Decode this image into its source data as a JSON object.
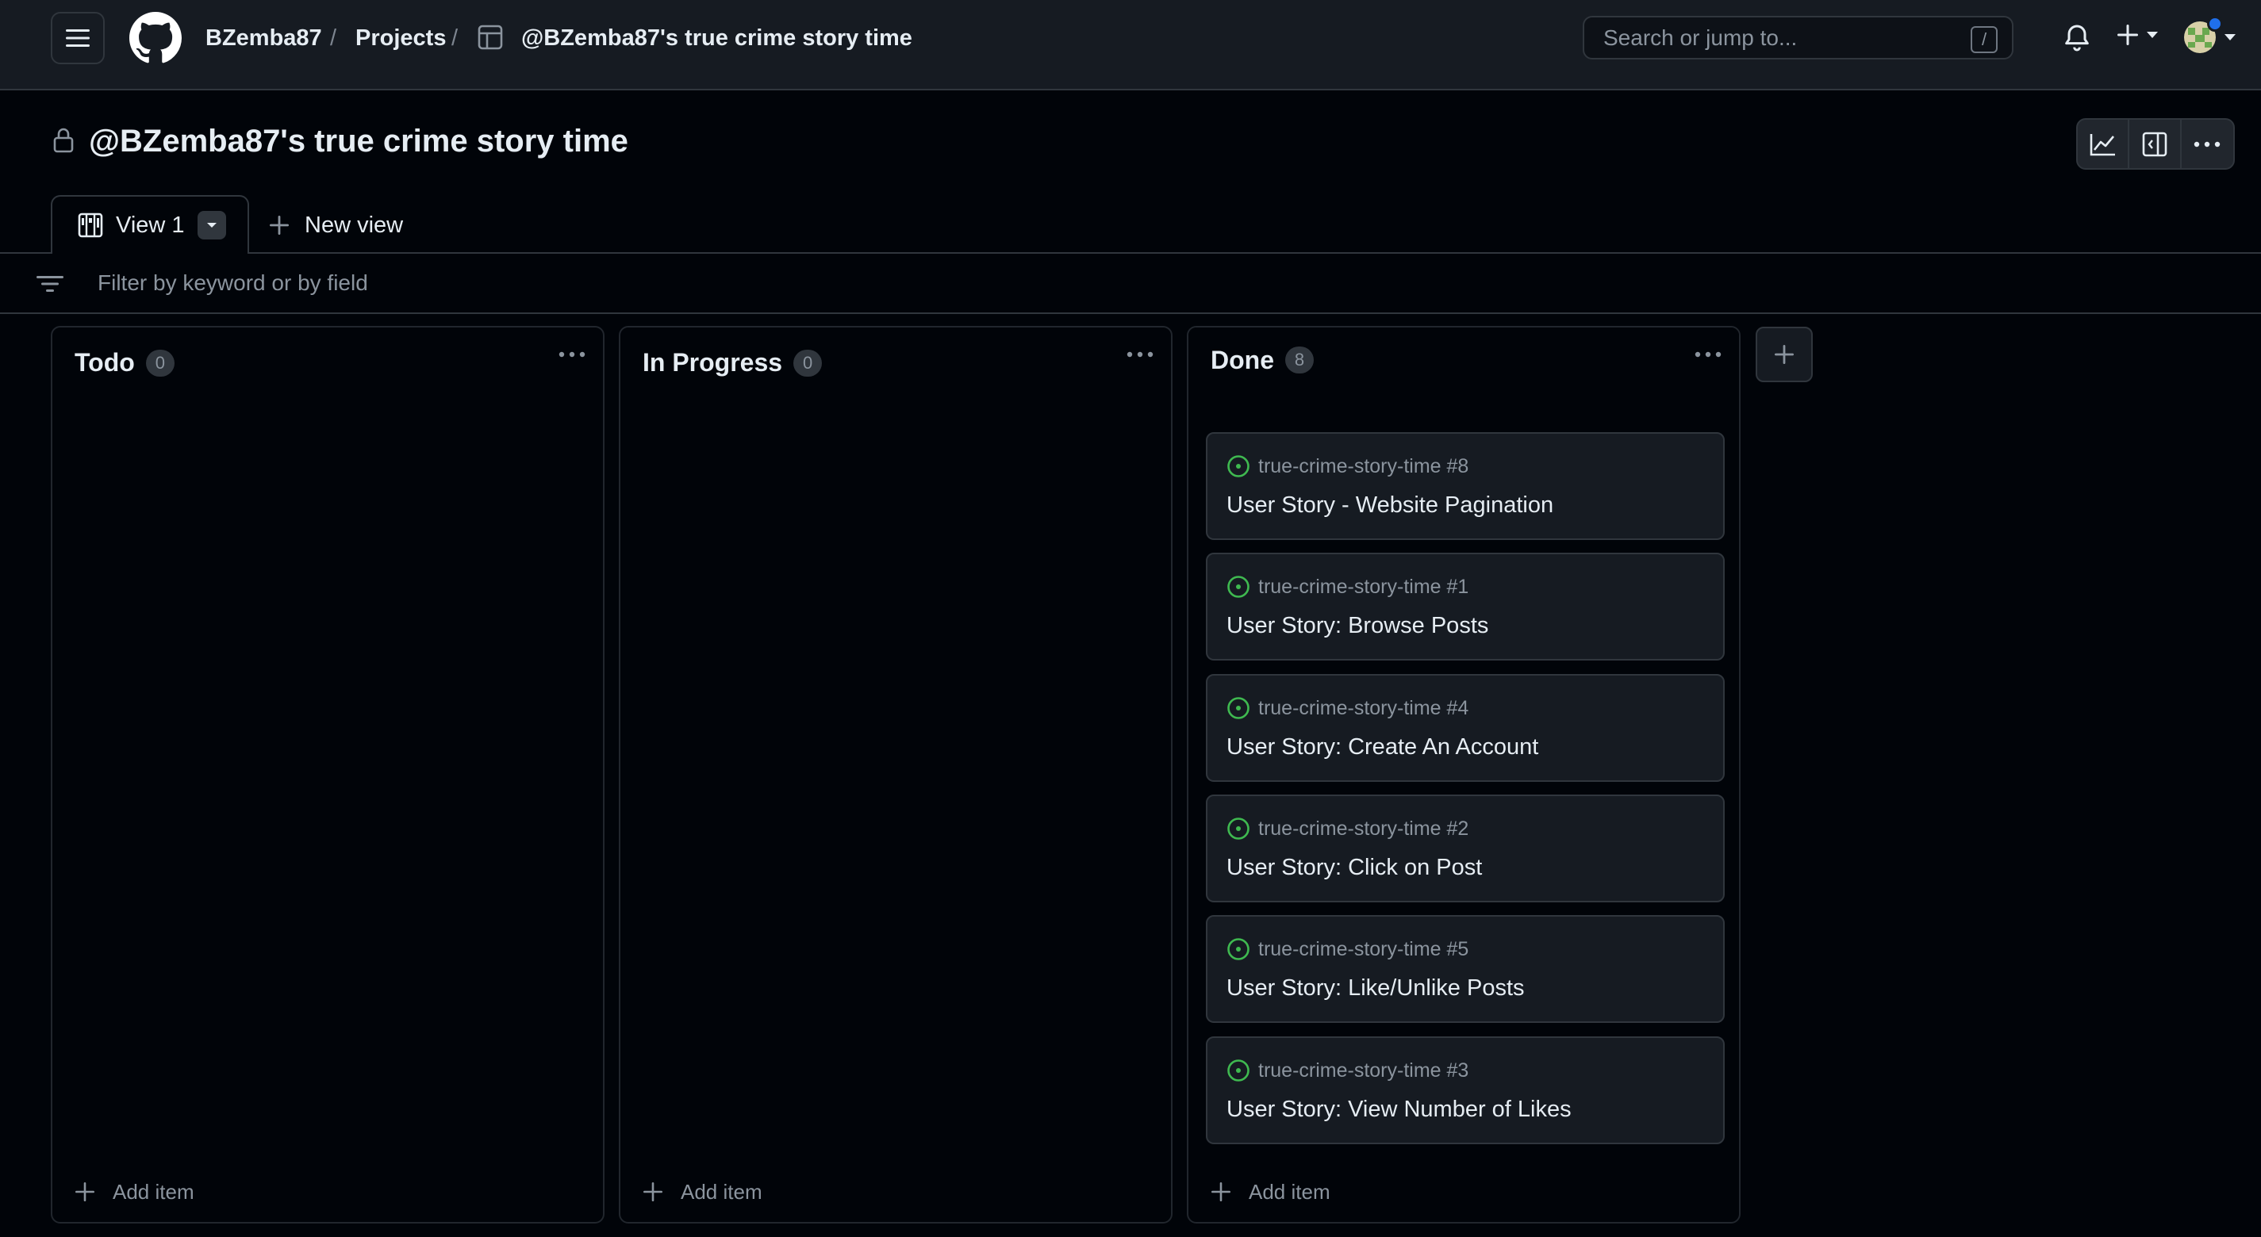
{
  "header": {
    "breadcrumb": {
      "owner": "BZemba87",
      "separator": "/",
      "projects": "Projects",
      "project": "@BZemba87's true crime story time"
    },
    "search": {
      "placeholder": "Search or jump to...",
      "shortcut": "/"
    },
    "icons": [
      "menu-icon",
      "github-logo",
      "project-table-icon",
      "bell-icon",
      "plus-icon",
      "avatar"
    ]
  },
  "project": {
    "title": "@BZemba87's true crime story time",
    "visibility_icon": "lock-icon",
    "actions": [
      "insights-graph-icon",
      "side-panel-icon",
      "more-options-icon"
    ]
  },
  "views": {
    "tabs": [
      {
        "label": "View 1",
        "icon": "board-icon"
      }
    ],
    "new_view_label": "New view"
  },
  "filter": {
    "placeholder": "Filter by keyword or by field"
  },
  "board": {
    "columns": [
      {
        "name": "Todo",
        "count": "0",
        "add_label": "Add item",
        "cards": []
      },
      {
        "name": "In Progress",
        "count": "0",
        "add_label": "Add item",
        "cards": []
      },
      {
        "name": "Done",
        "count": "8",
        "add_label": "Add item",
        "cards": [
          {
            "repo": "true-crime-story-time #8",
            "title": "User Story - Website Pagination"
          },
          {
            "repo": "true-crime-story-time #1",
            "title": "User Story: Browse Posts"
          },
          {
            "repo": "true-crime-story-time #4",
            "title": "User Story: Create An Account"
          },
          {
            "repo": "true-crime-story-time #2",
            "title": "User Story: Click on Post"
          },
          {
            "repo": "true-crime-story-time #5",
            "title": "User Story: Like/Unlike Posts"
          },
          {
            "repo": "true-crime-story-time #3",
            "title": "User Story: View Number of Likes"
          }
        ]
      }
    ]
  },
  "colors": {
    "background": "#010409",
    "header_bg": "#161b22",
    "border": "#30363d",
    "text": "#e6edf3",
    "muted": "#8b949e",
    "open_issue_green": "#3fb950",
    "notification_blue": "#1f6feb"
  }
}
